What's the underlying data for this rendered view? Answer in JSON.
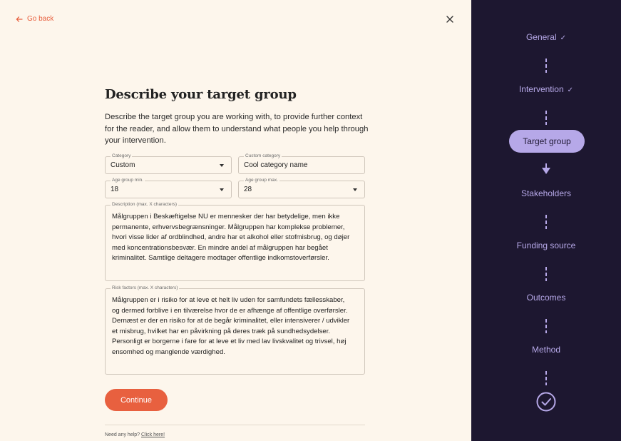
{
  "nav": {
    "go_back": "Go back"
  },
  "page": {
    "title": "Describe your target group",
    "intro": "Describe the target group you are working with, to provide further context for the reader, and allow them to understand what people you help through your intervention."
  },
  "form": {
    "category": {
      "label": "Category",
      "value": "Custom"
    },
    "custom_category": {
      "label": "Custom category",
      "value": "Cool category name"
    },
    "age_min": {
      "label": "Age group min.",
      "value": "18"
    },
    "age_max": {
      "label": "Age group max.",
      "value": "28"
    },
    "description": {
      "label": "Description (max. X characters)",
      "value": "Målgruppen i Beskæftigelse NU er mennesker der har betydelige, men ikke permanente, erhvervsbegrænsninger. Målgruppen har komplekse problemer, hvori visse lider af ordblindhed, andre har et alkohol eller stofmisbrug, og døjer med koncentrationsbesvær. En mindre andel af målgruppen har begået kriminalitet. Samtlige deltagere modtager offentlige indkomstoverførsler."
    },
    "risk_factors": {
      "label": "Risk factors (max. X characters)",
      "value": "Målgruppen er i risiko for at leve et helt liv uden for samfundets fællesskaber, og dermed forblive i en tilværelse hvor de er afhænge af offentlige overførsler. Dernæst er der en risiko for at de begår kriminalitet, eller intensiverer / udvikler et misbrug, hvilket har en påvirkning på deres træk på  sundhedsydelser. Personligt er borgerne i fare for at leve et liv med lav livskvalitet og trivsel, høj ensomhed og manglende værdighed."
    },
    "continue_label": "Continue"
  },
  "help": {
    "prefix": "Need any help?",
    "link": "Click here!"
  },
  "steps": {
    "general": "General",
    "intervention": "Intervention",
    "target_group": "Target group",
    "stakeholders": "Stakeholders",
    "funding_source": "Funding source",
    "outcomes": "Outcomes",
    "method": "Method"
  },
  "colors": {
    "accent": "#e8603f",
    "sidebar_bg": "#1d1730",
    "step_color": "#b6a8e8",
    "page_bg": "#fdf6ec"
  }
}
